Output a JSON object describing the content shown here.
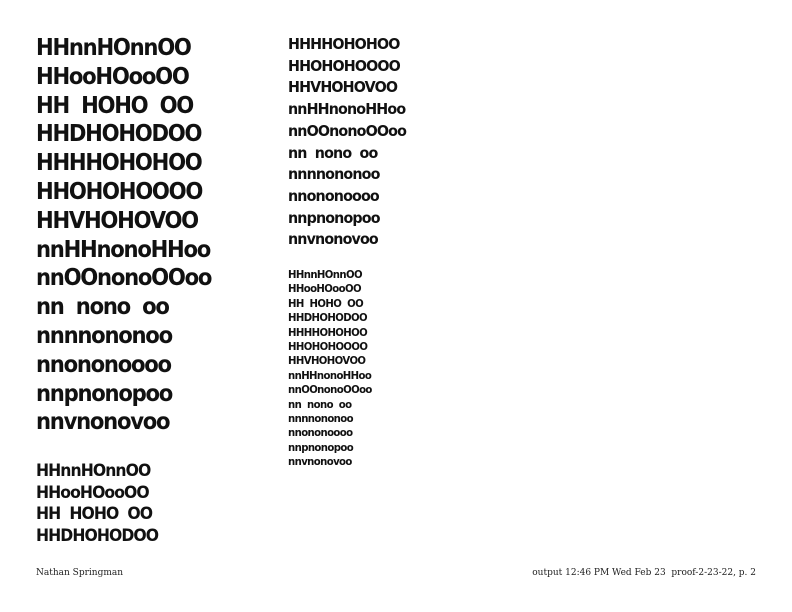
{
  "blocks": {
    "large": {
      "lines": [
        "HHnnHOnnOO",
        "HHooHOooOO",
        "HH  HOHO  OO",
        "HHDHOHODOO",
        "HHHHOHOHOO",
        "HHOHOHOOOO",
        "HHVHOHOVOO",
        "nnHHnonoHHoo",
        "nnOOnonoOOoo",
        "nn  nono  oo",
        "nnnnononoo",
        "nnononoooo",
        "nnpnonopoo",
        "nnvnonovoo"
      ]
    },
    "medium_left": {
      "lines": [
        "HHnnHOnnOO",
        "HHooHOooOO",
        "HH  HOHO  OO",
        "HHDHOHODOO"
      ]
    },
    "medium_right": {
      "lines": [
        "HHHHOHOHOO",
        "HHOHOHOOOO",
        "HHVHOHOVOO",
        "nnHHnonoHHoo",
        "nnOOnonoOOoo",
        "nn  nono  oo",
        "nnnnononoo",
        "nnononoooo",
        "nnpnonopoo",
        "nnvnonovoo"
      ]
    },
    "small": {
      "lines": [
        "HHnnHOnnOO",
        "HHooHOooOO",
        "HH  HOHO  OO",
        "HHDHOHODOO",
        "HHHHOHOHOO",
        "HHOHOHOOOO",
        "HHVHOHOVOO",
        "nnHHnonoHHoo",
        "nnOOnonoOOoo",
        "nn  nono  oo",
        "nnnnononoo",
        "nnononoooo",
        "nnpnonopoo",
        "nnvnonovoo"
      ]
    }
  },
  "footer": {
    "left": "Nathan Springman",
    "right": "output 12:46 PM Wed Feb 23  proof-2-23-22, p. 2"
  }
}
